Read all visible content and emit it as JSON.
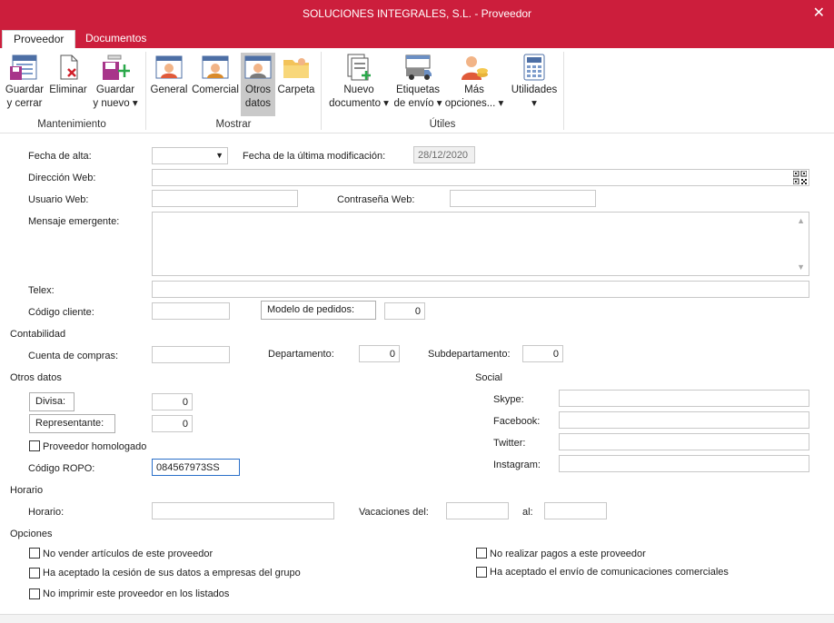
{
  "window": {
    "title": "SOLUCIONES INTEGRALES, S.L. - Proveedor",
    "close": "✕"
  },
  "tabs": [
    "Proveedor",
    "Documentos"
  ],
  "ribbon": {
    "buttons": [
      {
        "line1": "Guardar",
        "line2": "y cerrar"
      },
      {
        "line1": "Eliminar",
        "line2": ""
      },
      {
        "line1": "Guardar",
        "line2": "y nuevo ▾"
      },
      {
        "line1": "General",
        "line2": ""
      },
      {
        "line1": "Comercial",
        "line2": ""
      },
      {
        "line1": "Otros",
        "line2": "datos"
      },
      {
        "line1": "Carpeta",
        "line2": ""
      },
      {
        "line1": "Nuevo",
        "line2": "documento ▾"
      },
      {
        "line1": "Etiquetas",
        "line2": "de envío ▾"
      },
      {
        "line1": "Más",
        "line2": "opciones... ▾"
      },
      {
        "line1": "Utilidades",
        "line2": "▾"
      }
    ],
    "groups": [
      "Mantenimiento",
      "Mostrar",
      "Útiles"
    ]
  },
  "form": {
    "fecha_alta": "Fecha de alta:",
    "fecha_mod": "Fecha de la última modificación:",
    "fecha_mod_value": "28/12/2020",
    "direccion_web": "Dirección Web:",
    "usuario_web": "Usuario Web:",
    "contrasena_web": "Contraseña Web:",
    "mensaje": "Mensaje emergente:",
    "telex": "Telex:",
    "codigo_cliente": "Código cliente:",
    "modelo_pedidos": "Modelo de pedidos:",
    "modelo_pedidos_value": "0",
    "contabilidad": "Contabilidad",
    "cuenta_compras": "Cuenta de compras:",
    "departamento": "Departamento:",
    "departamento_value": "0",
    "subdepartamento": "Subdepartamento:",
    "subdepartamento_value": "0",
    "otros_datos": "Otros datos",
    "divisa": "Divisa:",
    "divisa_value": "0",
    "representante": "Representante:",
    "representante_value": "0",
    "homologado": "Proveedor homologado",
    "codigo_ropo": "Código ROPO:",
    "codigo_ropo_value": "084567973SS",
    "social": "Social",
    "skype": "Skype:",
    "facebook": "Facebook:",
    "twitter": "Twitter:",
    "instagram": "Instagram:",
    "horario_sec": "Horario",
    "horario": "Horario:",
    "vacaciones": "Vacaciones del:",
    "al": "al:",
    "opciones": "Opciones",
    "opt1": "No vender artículos de este proveedor",
    "opt2": "Ha aceptado la cesión de sus datos a empresas del grupo",
    "opt3": "No imprimir este proveedor en los listados",
    "opt4": "No realizar pagos a este proveedor",
    "opt5": "Ha aceptado el envío de comunicaciones comerciales"
  }
}
